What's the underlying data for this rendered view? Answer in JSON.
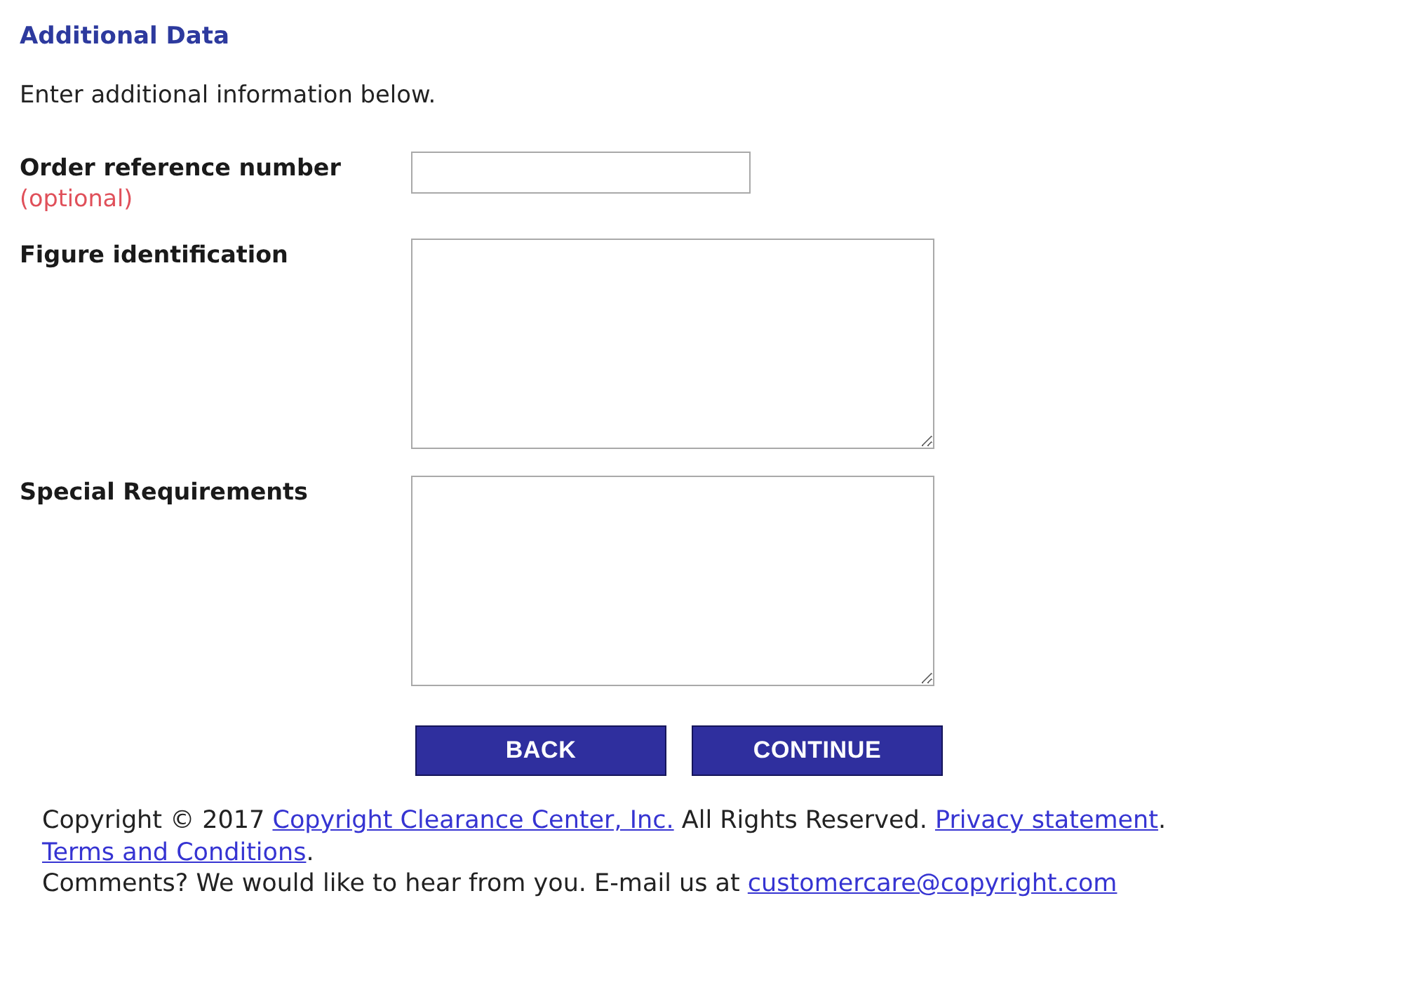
{
  "heading": "Additional Data",
  "intro": "Enter additional information below.",
  "fields": [
    {
      "kind": "input",
      "label": "Order reference number",
      "note": "(optional)"
    },
    {
      "kind": "textarea",
      "label": "Figure identification"
    },
    {
      "kind": "textarea",
      "label": "Special Requirements"
    }
  ],
  "buttons": [
    "BACK",
    "CONTINUE"
  ],
  "footer": {
    "lines": [
      [
        {
          "kind": "text",
          "text": "Copyright © 2017 "
        },
        {
          "kind": "link",
          "text": "Copyright Clearance Center, Inc."
        },
        {
          "kind": "text",
          "text": " All Rights Reserved. "
        },
        {
          "kind": "link",
          "text": "Privacy statement"
        },
        {
          "kind": "text",
          "text": ". "
        },
        {
          "kind": "link",
          "text": "Terms and Conditions"
        },
        {
          "kind": "text",
          "text": "."
        }
      ],
      [
        {
          "kind": "text",
          "text": "Comments? We would like to hear from you. E-mail us at "
        },
        {
          "kind": "link",
          "text": "customercare@copyright.com"
        }
      ]
    ]
  }
}
